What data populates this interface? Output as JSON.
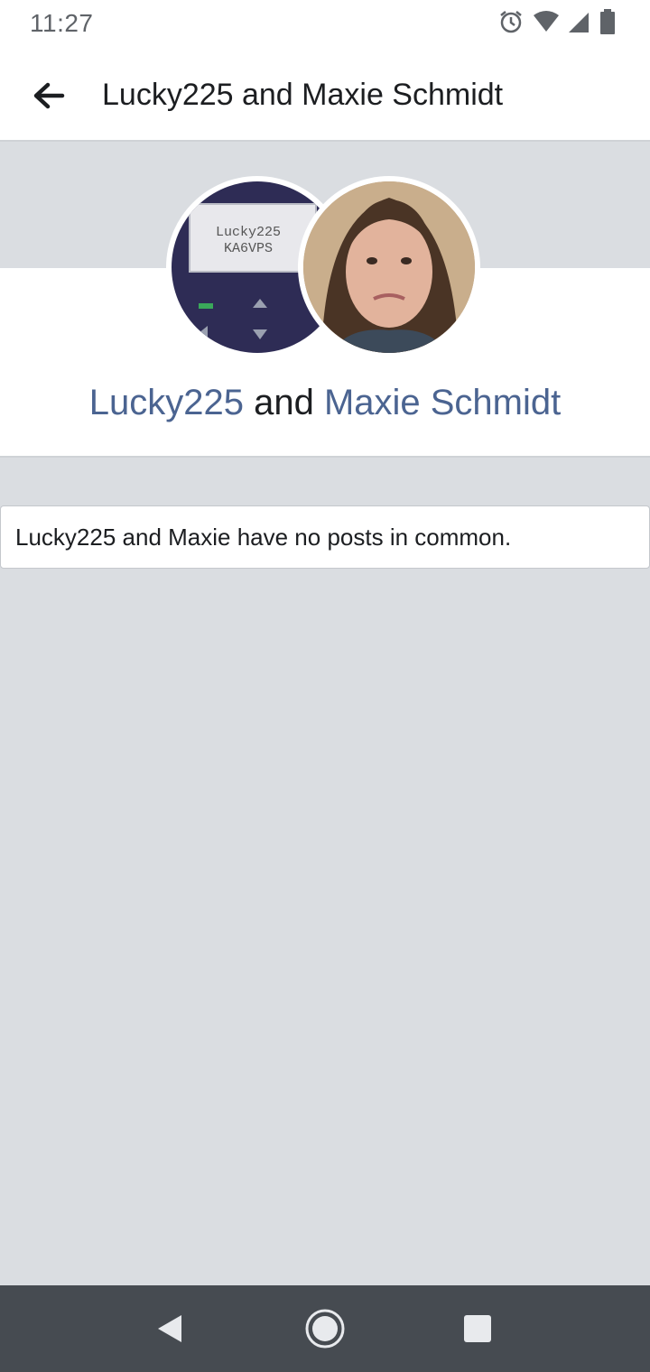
{
  "status_bar": {
    "time": "11:27",
    "icons": [
      "alarm-icon",
      "wifi-icon",
      "signal-icon",
      "battery-icon"
    ]
  },
  "app_bar": {
    "back_icon": "arrow-left-icon",
    "title": "Lucky225 and Maxie Schmidt"
  },
  "profiles": {
    "first": {
      "name": "Lucky225",
      "avatar_text_line1": "Lucky225",
      "avatar_text_line2": "KA6VPS"
    },
    "conjunction": " and ",
    "second": {
      "name": "Maxie Schmidt"
    }
  },
  "empty_state": {
    "message": "Lucky225 and Maxie have no posts in common."
  },
  "nav_bar": {
    "back": "back-triangle-icon",
    "home": "home-circle-icon",
    "recents": "recents-square-icon"
  },
  "colors": {
    "link": "#4b6491",
    "background": "#dadde1",
    "nav_bar": "#464b51"
  }
}
